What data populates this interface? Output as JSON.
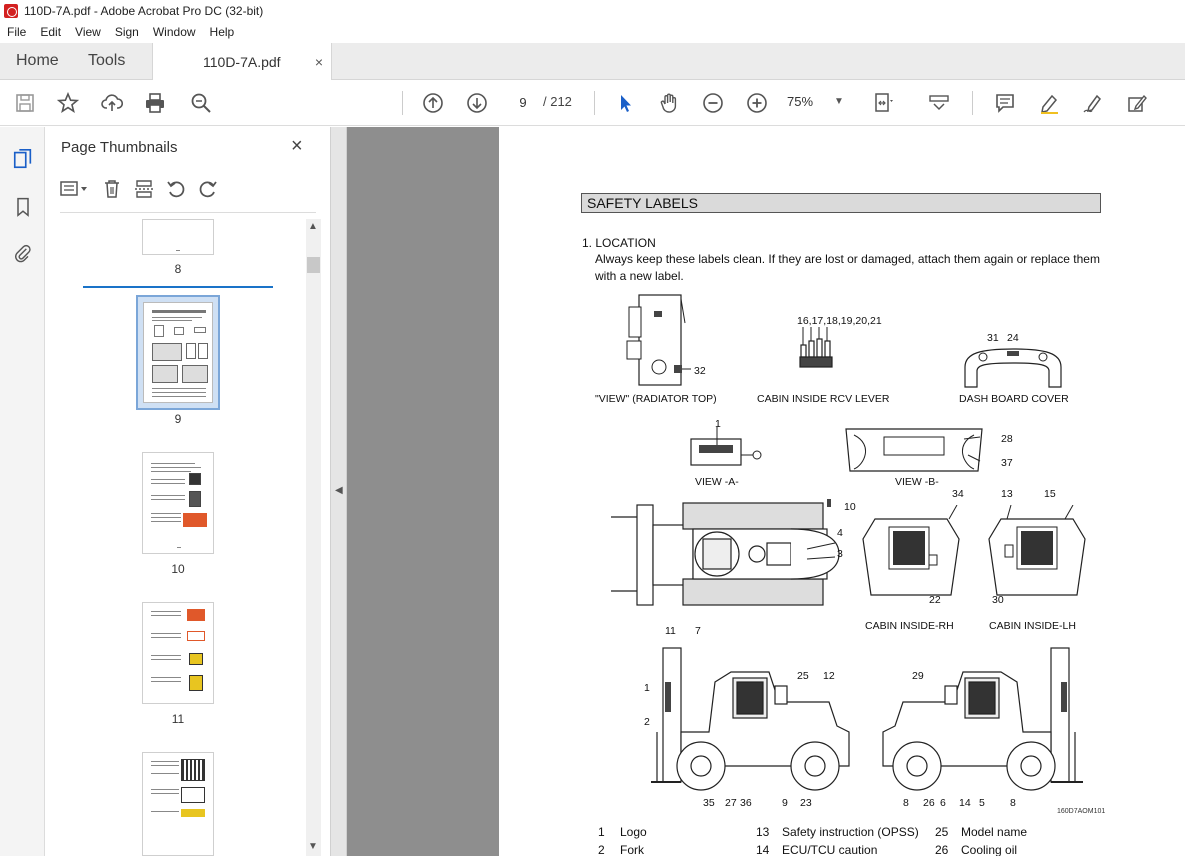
{
  "window": {
    "title": "110D-7A.pdf - Adobe Acrobat Pro DC (32-bit)"
  },
  "menu": [
    "File",
    "Edit",
    "View",
    "Sign",
    "Window",
    "Help"
  ],
  "tabs": {
    "home": "Home",
    "tools": "Tools",
    "document": "110D-7A.pdf",
    "close": "×"
  },
  "toolbar": {
    "page_current": "9",
    "page_total": "/ 212",
    "zoom": "75%"
  },
  "thumbnails": {
    "title": "Page Thumbnails",
    "close": "×",
    "pages": [
      "8",
      "9",
      "10",
      "11"
    ]
  },
  "document": {
    "section_title": "SAFETY LABELS",
    "location_heading": "1. LOCATION",
    "location_desc": "Always keep these labels clean.  If they are lost or damaged, attach them again or replace them with a new label.",
    "figures": {
      "view_radiator": "\"VIEW\" (RADIATOR TOP)",
      "cabin_rcv": "CABIN INSIDE RCV LEVER",
      "dash_board": "DASH BOARD COVER",
      "view_a": "VIEW -A-",
      "view_b": "VIEW -B-",
      "cabin_rh": "CABIN INSIDE-RH",
      "cabin_lh": "CABIN INSIDE-LH",
      "figure_code": "160D7AOM101"
    },
    "callouts": {
      "c32": "32",
      "c1621": "16,17,18,19,20,21",
      "c31": "31",
      "c24": "24",
      "c1a": "1",
      "c28": "28",
      "c37": "37",
      "c10": "10",
      "c4": "4",
      "c3": "3",
      "c34": "34",
      "c13": "13",
      "c15": "15",
      "c22": "22",
      "c30": "30",
      "c11": "11",
      "c7": "7",
      "c1b": "1",
      "c2": "2",
      "c25": "25",
      "c12": "12",
      "c29": "29",
      "c35": "35",
      "c27": "27",
      "c36": "36",
      "c9": "9",
      "c23": "23",
      "c8a": "8",
      "c26": "26",
      "c6": "6",
      "c14": "14",
      "c5": "5",
      "c8b": "8"
    },
    "legend": [
      {
        "num": "1",
        "text": "Logo"
      },
      {
        "num": "2",
        "text": "Fork"
      },
      {
        "num": "13",
        "text": "Safety instruction (OPSS)"
      },
      {
        "num": "14",
        "text": "ECU/TCU caution"
      },
      {
        "num": "25",
        "text": "Model name"
      },
      {
        "num": "26",
        "text": "Cooling oil"
      }
    ]
  }
}
